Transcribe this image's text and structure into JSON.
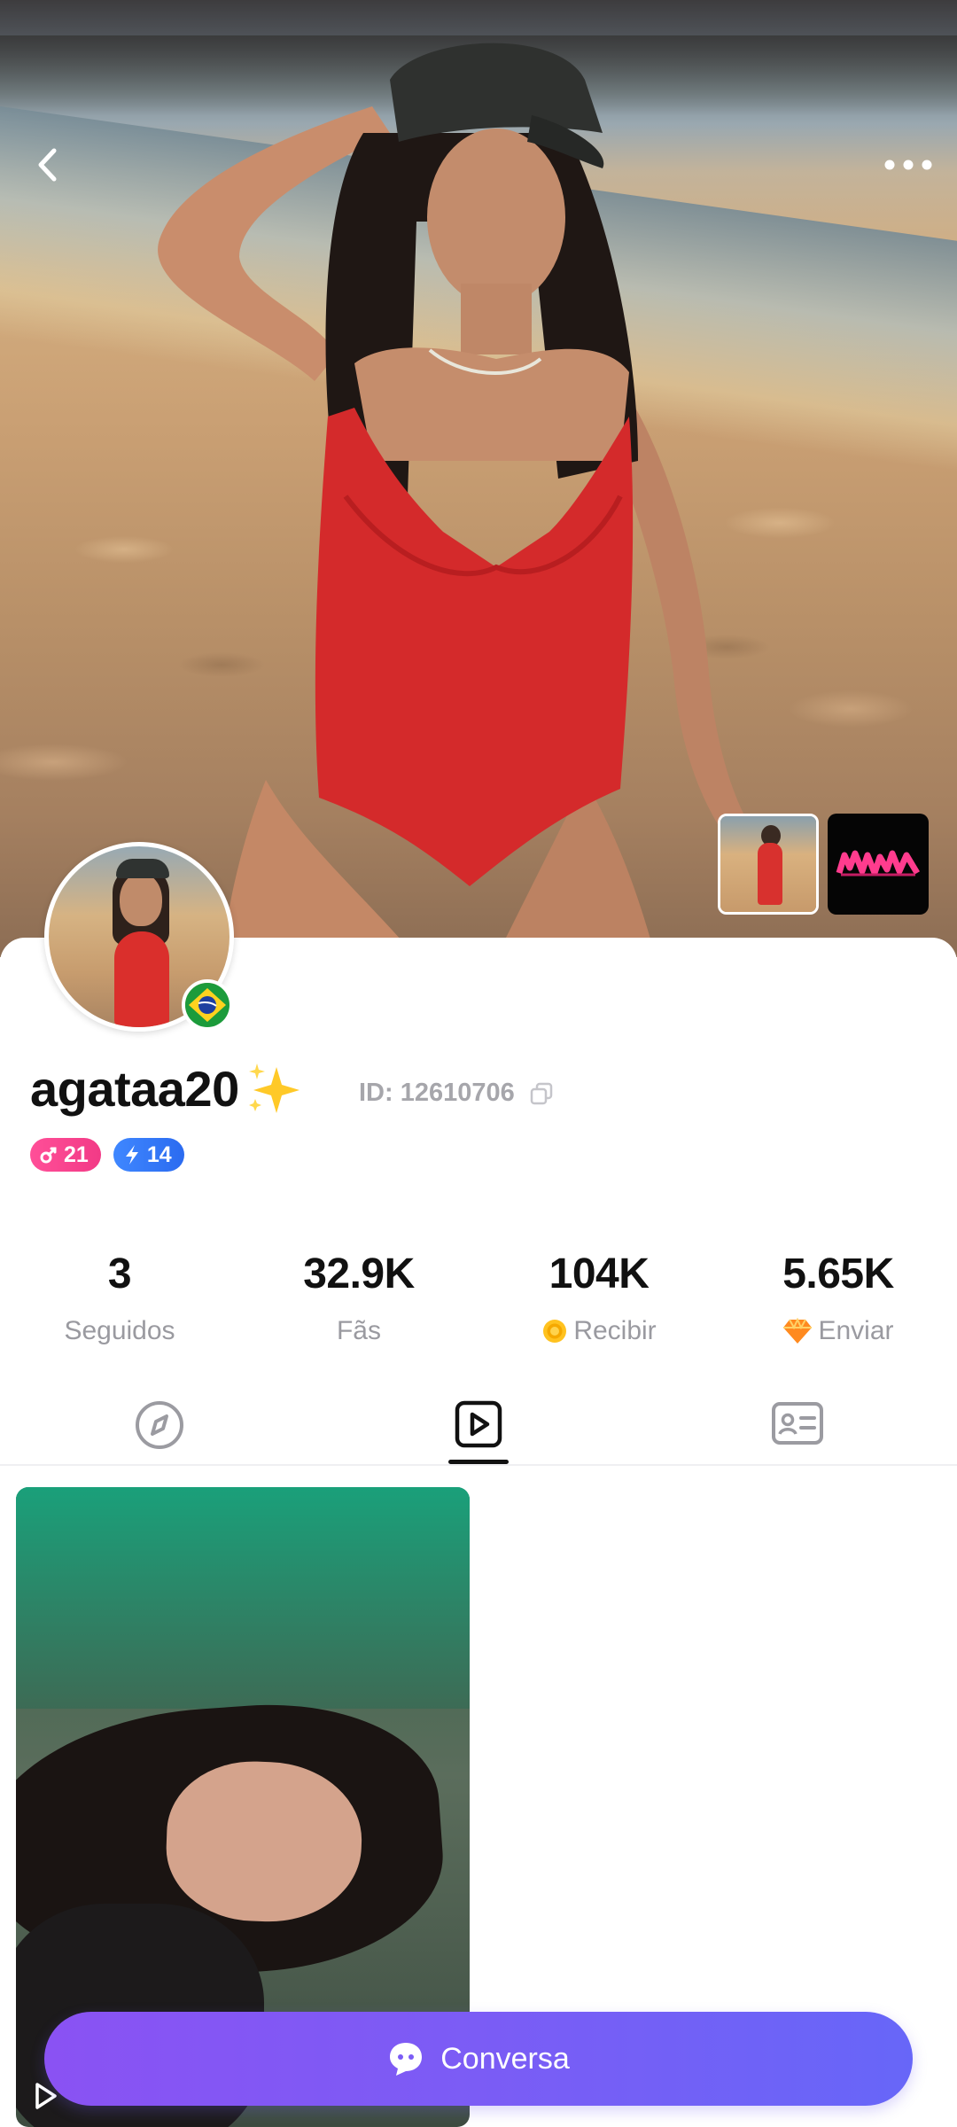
{
  "profile": {
    "username": "agataa20",
    "id_label": "ID: 12610706",
    "country_flag": "brazil-flag",
    "badges": [
      {
        "value": "21",
        "color": "#f23a86",
        "icon": "link-icon"
      },
      {
        "value": "14",
        "color": "#2b6bf0",
        "icon": "lightning-icon"
      }
    ]
  },
  "stats": [
    {
      "value": "3",
      "label": "Seguidos"
    },
    {
      "value": "32.9K",
      "label": "Fãs"
    },
    {
      "value": "104K",
      "label": "Recibir"
    },
    {
      "value": "5.65K",
      "label": "Enviar"
    }
  ],
  "tabs": [
    {
      "icon": "compass-icon",
      "active": false
    },
    {
      "icon": "video-play-icon",
      "active": true
    },
    {
      "icon": "profile-card-icon",
      "active": false
    }
  ],
  "chat_button": {
    "label": "Conversa"
  },
  "colors": {
    "accent_start": "#8a52f3",
    "accent_end": "#6766f8",
    "badge_pink": "#f23a86",
    "badge_blue": "#2b6bf0",
    "muted_text": "#9a9aa0"
  }
}
